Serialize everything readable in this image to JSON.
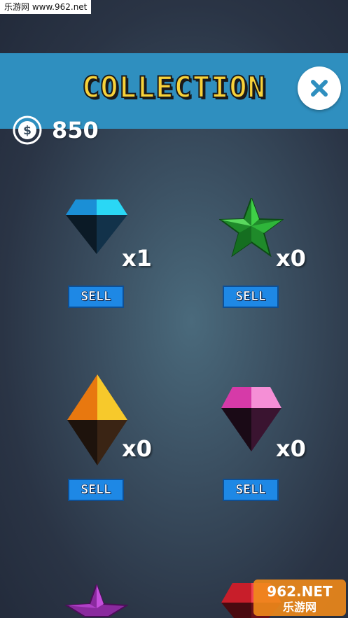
{
  "watermark_top": "乐游网 www.962.net",
  "header": {
    "title": "COLLECTION"
  },
  "currency": {
    "amount": "850",
    "icon": "dollar-coin-icon"
  },
  "items": [
    {
      "gem": "blue-diamond",
      "quantity": "x1",
      "sell_label": "SELL"
    },
    {
      "gem": "green-star",
      "quantity": "x0",
      "sell_label": "SELL"
    },
    {
      "gem": "orange-crystal",
      "quantity": "x0",
      "sell_label": "SELL"
    },
    {
      "gem": "pink-gem",
      "quantity": "x0",
      "sell_label": "SELL"
    },
    {
      "gem": "purple-star"
    },
    {
      "gem": "red-gem"
    }
  ],
  "watermark_bottom": {
    "logo": "962.NET",
    "text": "乐游网"
  },
  "colors": {
    "header_bar": "#2f8fbf",
    "title_yellow": "#f7d23a",
    "sell_button": "#1e88e5"
  }
}
